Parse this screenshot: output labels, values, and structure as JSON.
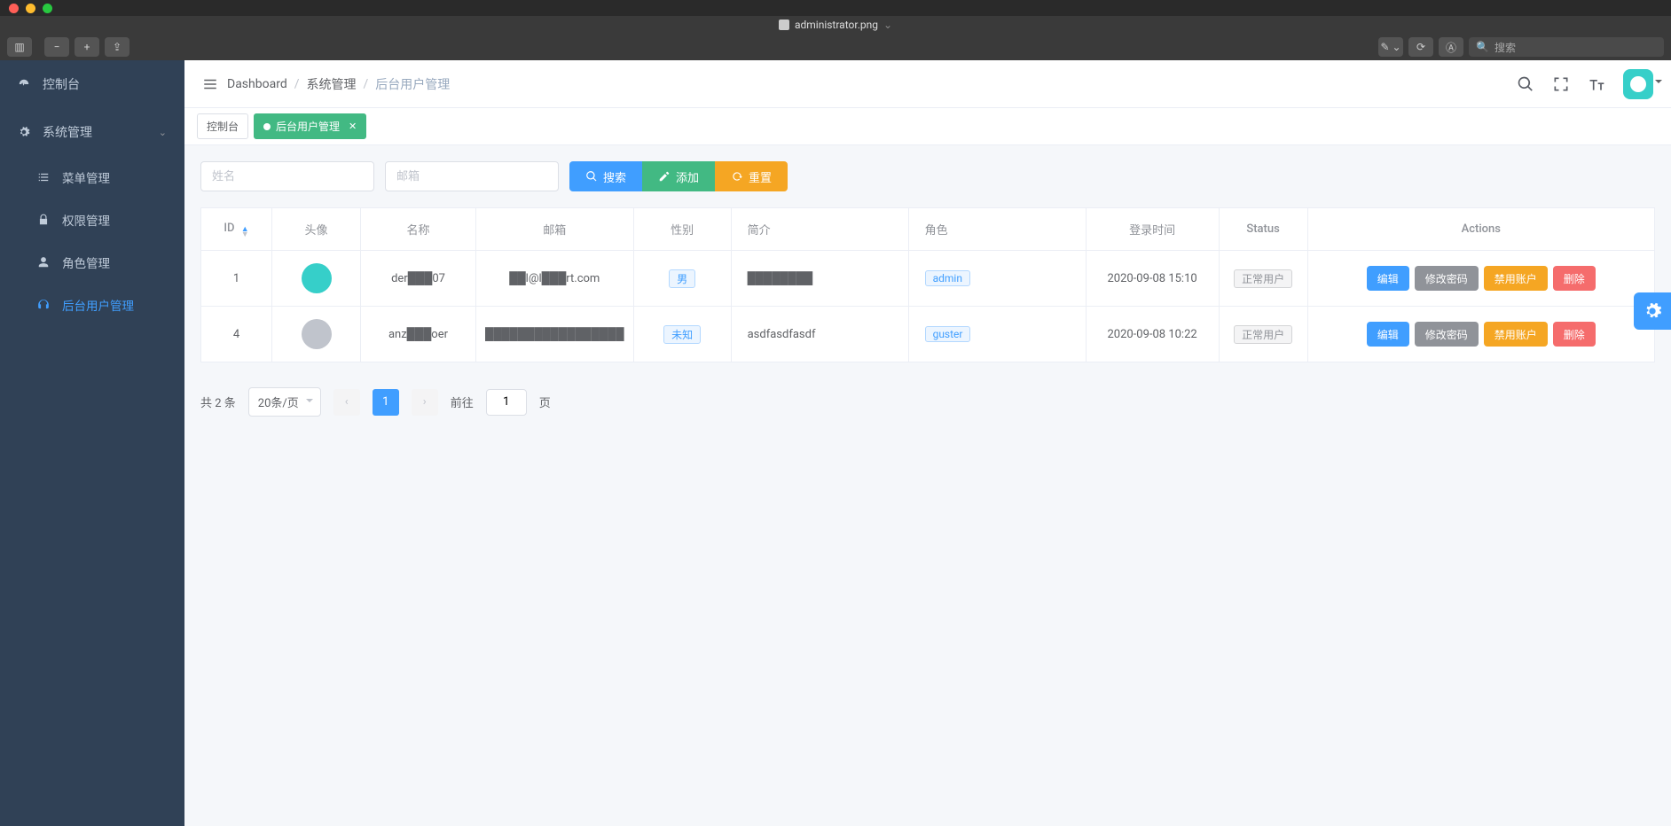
{
  "window": {
    "filename": "administrator.png"
  },
  "mac_toolbar": {
    "search_placeholder": "搜索"
  },
  "sidebar": {
    "items": [
      {
        "label": "控制台"
      },
      {
        "label": "系统管理"
      }
    ],
    "submenu": [
      {
        "label": "菜单管理"
      },
      {
        "label": "权限管理"
      },
      {
        "label": "角色管理"
      },
      {
        "label": "后台用户管理"
      }
    ]
  },
  "breadcrumb": {
    "i1": "Dashboard",
    "i2": "系统管理",
    "i3": "后台用户管理"
  },
  "tabs": [
    {
      "label": "控制台"
    },
    {
      "label": "后台用户管理"
    }
  ],
  "filters": {
    "name_placeholder": "姓名",
    "email_placeholder": "邮箱",
    "search_label": "搜索",
    "add_label": "添加",
    "reset_label": "重置"
  },
  "table": {
    "headers": {
      "id": "ID",
      "avatar": "头像",
      "name": "名称",
      "email": "邮箱",
      "gender": "性别",
      "intro": "简介",
      "role": "角色",
      "login_time": "登录时间",
      "status": "Status",
      "actions": "Actions"
    },
    "rows": [
      {
        "id": "1",
        "name": "der███07",
        "email": "██l@l███rt.com",
        "gender": "男",
        "intro": "████████",
        "role": "admin",
        "login_time": "2020-09-08 15:10",
        "status": "正常用户",
        "avatar": "teal"
      },
      {
        "id": "4",
        "name": "anz███oer",
        "email": "█████████████████",
        "gender": "未知",
        "intro": "asdfasdfasdf",
        "role": "guster",
        "login_time": "2020-09-08 10:22",
        "status": "正常用户",
        "avatar": "grey"
      }
    ],
    "actions": {
      "edit": "编辑",
      "pwd": "修改密码",
      "disable": "禁用账户",
      "delete": "删除"
    }
  },
  "pager": {
    "total": "共 2 条",
    "page_size": "20条/页",
    "current": "1",
    "goto_prefix": "前往",
    "goto_value": "1",
    "goto_suffix": "页"
  }
}
